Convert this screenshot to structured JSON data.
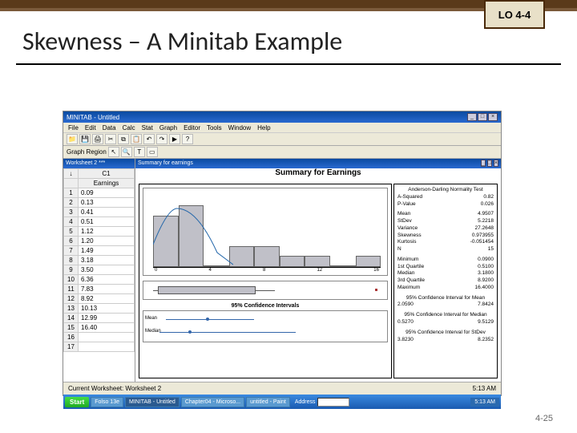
{
  "badge": "LO 4-4",
  "slide_title": "Skewness – A Minitab Example",
  "slide_number": "4-25",
  "app": {
    "title": "MINITAB - Untitled",
    "menu": [
      "File",
      "Edit",
      "Data",
      "Calc",
      "Stat",
      "Graph",
      "Editor",
      "Tools",
      "Window",
      "Help"
    ],
    "session_label": "Graph Region",
    "worksheet_title": "Worksheet 2 ***",
    "graph_win_title": "Summary for earnings",
    "col_header": "C1",
    "col_name": "Earnings",
    "rows": [
      "0.09",
      "0.13",
      "0.41",
      "0.51",
      "1.12",
      "1.20",
      "1.49",
      "3.18",
      "3.50",
      "6.36",
      "7.83",
      "8.92",
      "10.13",
      "12.99",
      "16.40",
      "",
      ""
    ],
    "statusbar": "Current Worksheet: Worksheet 2",
    "status_time": "5:13 AM"
  },
  "summary": {
    "title": "Summary for Earnings",
    "ci_title": "95% Confidence Intervals",
    "ci_labels": [
      "Mean",
      "Median"
    ],
    "hist_ticks": [
      "0",
      "4",
      "8",
      "12",
      "16"
    ]
  },
  "chart_data": {
    "type": "bar",
    "title": "Summary for Earnings",
    "categories": [
      0,
      2,
      4,
      6,
      8,
      10,
      12,
      14,
      16
    ],
    "values": [
      5,
      6,
      0,
      2,
      2,
      1,
      1,
      0,
      1
    ],
    "xlabel": "",
    "ylabel": "",
    "ylim": [
      0,
      6
    ]
  },
  "stats": {
    "normality_h": "Anderson-Darling Normality Test",
    "a_sq": {
      "label": "A-Squared",
      "val": "0.82"
    },
    "pval": {
      "label": "P-Value",
      "val": "0.026"
    },
    "mean": {
      "label": "Mean",
      "val": "4.9507"
    },
    "stdev": {
      "label": "StDev",
      "val": "5.2218"
    },
    "var": {
      "label": "Variance",
      "val": "27.2648"
    },
    "skew": {
      "label": "Skewness",
      "val": "0.973955"
    },
    "kurt": {
      "label": "Kurtosis",
      "val": "-0.051454"
    },
    "n": {
      "label": "N",
      "val": "15"
    },
    "min": {
      "label": "Minimum",
      "val": "0.0900"
    },
    "q1": {
      "label": "1st Quartile",
      "val": "0.5100"
    },
    "med": {
      "label": "Median",
      "val": "3.1800"
    },
    "q3": {
      "label": "3rd Quartile",
      "val": "8.9200"
    },
    "max": {
      "label": "Maximum",
      "val": "16.4000"
    },
    "cim_h": "95% Confidence Interval for Mean",
    "cim": {
      "lo": "2.0590",
      "hi": "7.8424"
    },
    "cimed_h": "95% Confidence Interval for Median",
    "cimed": {
      "lo": "0.5270",
      "hi": "9.5129"
    },
    "cisd_h": "95% Confidence Interval for StDev",
    "cisd": {
      "lo": "3.8230",
      "hi": "8.2352"
    }
  },
  "taskbar": {
    "start": "Start",
    "items": [
      "Folso 13e",
      "MINITAB - Untitled",
      "Chapter04 - Microso...",
      "untitled - Paint"
    ],
    "addr_label": "Address",
    "time": "5:13 AM"
  }
}
